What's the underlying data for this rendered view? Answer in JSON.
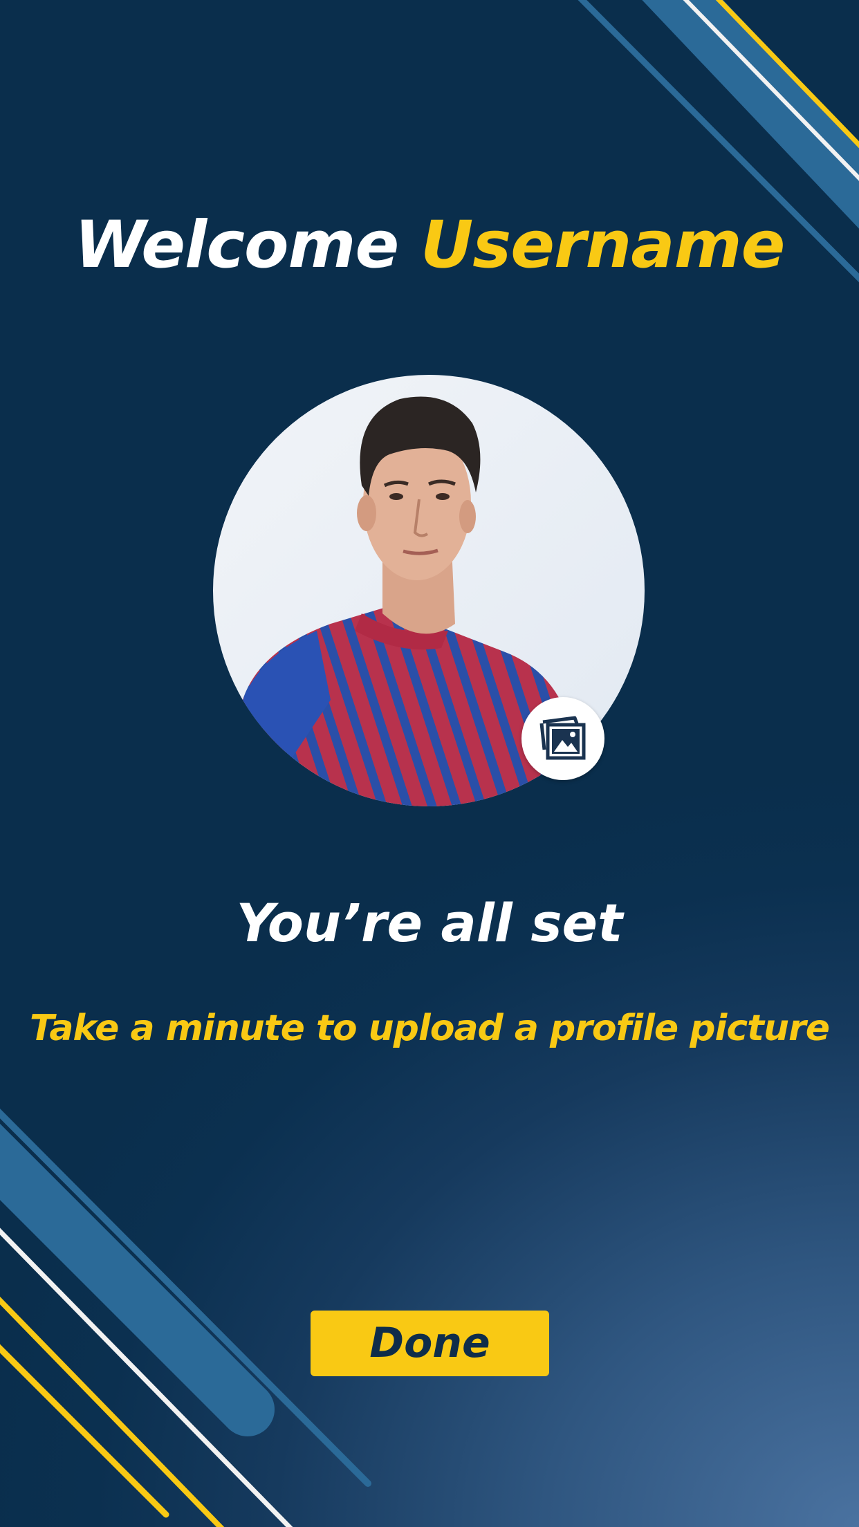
{
  "screen": {
    "welcome_text": "Welcome",
    "username": "Username",
    "heading": "You’re all set",
    "subtext": "Take a minute to upload a profile picture",
    "done_label": "Done"
  },
  "avatar": {
    "icon": "gallery-icon",
    "image": "profile-photo"
  },
  "colors": {
    "background": "#0a2e4c",
    "accent": "#f9c914",
    "stripe_blue": "#2b6a98",
    "text": "#ffffff",
    "button_text": "#0f2d4a"
  }
}
